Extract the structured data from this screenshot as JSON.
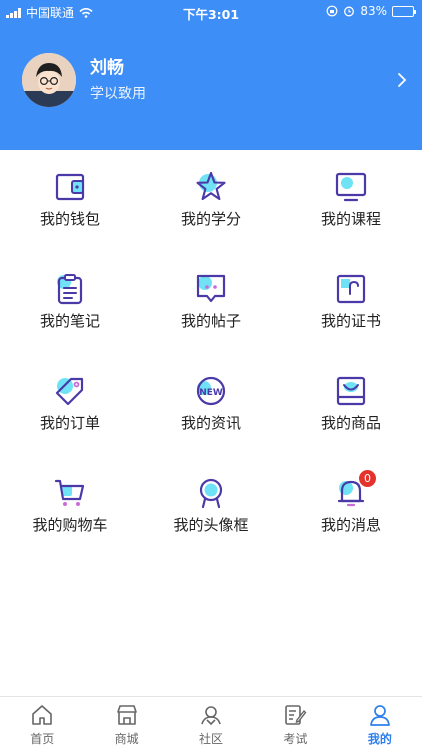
{
  "status_bar": {
    "carrier": "中国联通",
    "time": "下午3:01",
    "battery": "83%",
    "battery_level": 0.83
  },
  "profile": {
    "name": "刘畅",
    "motto": "学以致用"
  },
  "menu": [
    {
      "label": "我的钱包",
      "icon": "wallet-icon"
    },
    {
      "label": "我的学分",
      "icon": "star-icon"
    },
    {
      "label": "我的课程",
      "icon": "monitor-icon"
    },
    {
      "label": "我的笔记",
      "icon": "clipboard-icon"
    },
    {
      "label": "我的帖子",
      "icon": "chat-bubble-icon"
    },
    {
      "label": "我的证书",
      "icon": "certificate-icon"
    },
    {
      "label": "我的订单",
      "icon": "tag-icon"
    },
    {
      "label": "我的资讯",
      "icon": "new-badge-icon"
    },
    {
      "label": "我的商品",
      "icon": "product-icon"
    },
    {
      "label": "我的购物车",
      "icon": "cart-icon"
    },
    {
      "label": "我的头像框",
      "icon": "avatar-frame-icon"
    },
    {
      "label": "我的消息",
      "icon": "bell-icon",
      "badge": "0"
    }
  ],
  "tabs": [
    {
      "label": "首页",
      "icon": "home-icon"
    },
    {
      "label": "商城",
      "icon": "shop-icon"
    },
    {
      "label": "社区",
      "icon": "community-icon"
    },
    {
      "label": "考试",
      "icon": "exam-icon"
    },
    {
      "label": "我的",
      "icon": "user-icon",
      "active": true
    }
  ],
  "colors": {
    "header_bg": "#3e8ef7",
    "icon_stroke": "#4a3aa8",
    "icon_accent": "#6fe3f5",
    "active_tab": "#2f80ed",
    "badge": "#e5322d"
  }
}
